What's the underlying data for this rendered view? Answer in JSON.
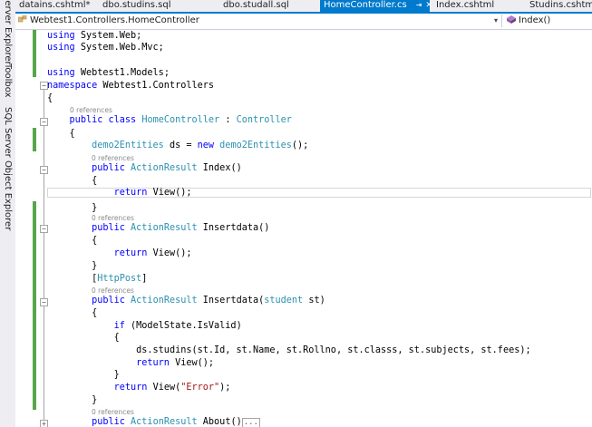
{
  "left_rail": [
    "Server Explorer",
    "Toolbox",
    "SQL Server Object Explorer"
  ],
  "tabs": [
    {
      "label": "datains.cshtml*",
      "active": false
    },
    {
      "label": "dbo.studins.sql",
      "active": false
    },
    {
      "label": "dbo.studall.sql",
      "active": false
    },
    {
      "label": "HomeController.cs",
      "active": true
    },
    {
      "label": "Index.cshtml",
      "active": false
    },
    {
      "label": "Studins.cshtml",
      "active": false
    }
  ],
  "tab_icons": {
    "pin": "pin-icon",
    "close": "close-icon"
  },
  "navbar": {
    "class_path": "Webtest1.Controllers.HomeController",
    "member": "Index()",
    "class_icon": "class-icon",
    "method_icon": "method-icon",
    "dropdown_icon": "chevron-down-icon"
  },
  "code": {
    "l1": [
      "using",
      "System.Web;"
    ],
    "l2": [
      "using",
      "System.Web.Mvc;"
    ],
    "l3": [
      "using",
      "Webtest1.Models;"
    ],
    "l4": [
      "namespace",
      "Webtest1.Controllers"
    ],
    "l5": "{",
    "ref1": "0 references",
    "l6": [
      "public",
      "class",
      "HomeController",
      ":",
      "Controller"
    ],
    "l7": "{",
    "l8": [
      "demo2Entities",
      "ds = ",
      "new",
      "demo2Entities",
      "();"
    ],
    "ref2": "0 references",
    "l9": [
      "public",
      "ActionResult",
      "Index()"
    ],
    "l10": "{",
    "l11": [
      "return",
      "View();"
    ],
    "l12": "}",
    "ref3": "0 references",
    "l13": [
      "public",
      "ActionResult",
      "Insertdata()"
    ],
    "l14": "{",
    "l15": [
      "return",
      "View();"
    ],
    "l16": "}",
    "l17": [
      "[",
      "HttpPost",
      "]"
    ],
    "ref4": "0 references",
    "l18": [
      "public",
      "ActionResult",
      "Insertdata(",
      "student",
      "st)"
    ],
    "l19": "{",
    "l20": [
      "if",
      "(ModelState.IsValid)"
    ],
    "l21": "{",
    "l22": "ds.studins(st.Id, st.Name, st.Rollno, st.classs, st.subjects, st.fees);",
    "l23": [
      "return",
      "View();"
    ],
    "l24": "}",
    "l25": [
      "return",
      "View(",
      "\"Error\"",
      ");"
    ],
    "l26": "}",
    "ref5": "0 references",
    "l27": [
      "public",
      "ActionResult",
      "About()",
      "..."
    ]
  },
  "colors": {
    "keyword": "#0000ff",
    "type": "#2b91af",
    "string": "#a31515",
    "active_tab": "#007acc",
    "change_bar": "#57a64a",
    "references": "#8a8a8a"
  }
}
